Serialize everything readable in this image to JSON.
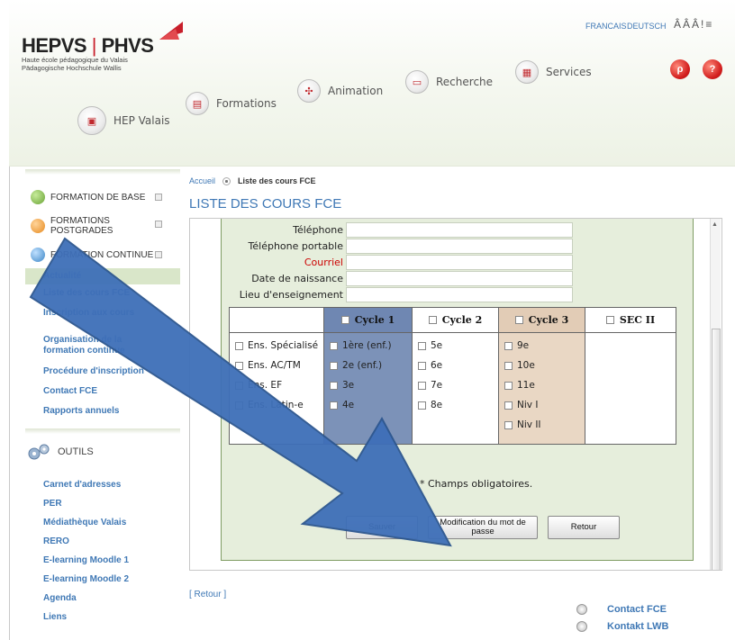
{
  "header": {
    "logo_left": "HEPVS",
    "logo_sep": "|",
    "logo_right": "PHVS",
    "tagline_1": "Haute école pédagogique du Valais",
    "tagline_2": "Pädagogische Hochschule Wallis",
    "lang_fr": "FRANCAIS",
    "lang_de": "DEUTSCH",
    "access_icons": "ÂÂÂ!≡",
    "nav": [
      {
        "label": "HEP Valais",
        "icon": "building-icon"
      },
      {
        "label": "Formations",
        "icon": "book-icon"
      },
      {
        "label": "Animation",
        "icon": "compass-icon"
      },
      {
        "label": "Recherche",
        "icon": "folder-icon"
      },
      {
        "label": "Services",
        "icon": "document-icon"
      }
    ],
    "search_btn": "ρ",
    "help_btn": "?"
  },
  "sidebar": {
    "main": [
      {
        "label": "FORMATION DE BASE",
        "color": "#6aa336"
      },
      {
        "label": "FORMATIONS POSTGRADES",
        "color": "#e68a1f"
      },
      {
        "label": "FORMATION CONTINUE",
        "color": "#3d86c6"
      }
    ],
    "sub": [
      {
        "label": "Actualité",
        "highlighted": true
      },
      {
        "label": "Liste des cours FCE",
        "highlighted": false
      },
      {
        "label": "Inscription aux cours",
        "highlighted": false
      },
      {
        "label": "Organisation de la formation continue",
        "highlighted": false
      },
      {
        "label": "Procédure d'inscription",
        "highlighted": false
      },
      {
        "label": "Contact FCE",
        "highlighted": false
      },
      {
        "label": "Rapports annuels",
        "highlighted": false
      }
    ],
    "tools_label": "OUTILS",
    "tools": [
      "Carnet d'adresses",
      "PER",
      "Médiathèque Valais",
      "RERO",
      "E-learning Moodle 1",
      "E-learning Moodle 2",
      "Agenda",
      "Liens"
    ]
  },
  "breadcrumb": {
    "home": "Accueil",
    "current": "Liste des cours FCE"
  },
  "page_title": "LISTE DES COURS FCE",
  "form": {
    "fields": [
      {
        "label": "Téléphone",
        "required": false
      },
      {
        "label": "Téléphone portable",
        "required": false
      },
      {
        "label": "Courriel",
        "required": true
      },
      {
        "label": "Date de naissance",
        "required": false
      },
      {
        "label": "Lieu d'enseignement",
        "required": false
      }
    ],
    "cycles": [
      {
        "head": "",
        "head_checkbox": false,
        "bg": "#ffffff",
        "items": [
          "Ens. Spécialisé",
          "Ens. AC/TM",
          "Ens. EF",
          "Ens. Latin-e"
        ]
      },
      {
        "head": "Cycle 1",
        "head_checkbox": true,
        "bg": "#7c92b8",
        "items": [
          "1ère (enf.)",
          "2e (enf.)",
          "3e",
          "4e"
        ]
      },
      {
        "head": "Cycle 2",
        "head_checkbox": true,
        "bg": "#ffffff",
        "items": [
          "5e",
          "6e",
          "7e",
          "8e"
        ]
      },
      {
        "head": "Cycle 3",
        "head_checkbox": true,
        "bg": "#e9d7c4",
        "items": [
          "9e",
          "10e",
          "11e",
          "Niv I",
          "Niv II"
        ]
      },
      {
        "head": "SEC II",
        "head_checkbox": true,
        "bg": "#ffffff",
        "items": []
      }
    ],
    "required_note": "* Champs obligatoires.",
    "btn_save": "Sauver",
    "btn_password": "Modification du mot de passe",
    "btn_back": "Retour"
  },
  "retour_link": "[ Retour ]",
  "footer": {
    "contact_fce": "Contact FCE",
    "kontakt_lwb": "Kontakt LWB"
  },
  "colors": {
    "brand_blue": "#3f78b5",
    "brand_red": "#c81e2a",
    "arrow_blue": "#3e6fb8"
  }
}
